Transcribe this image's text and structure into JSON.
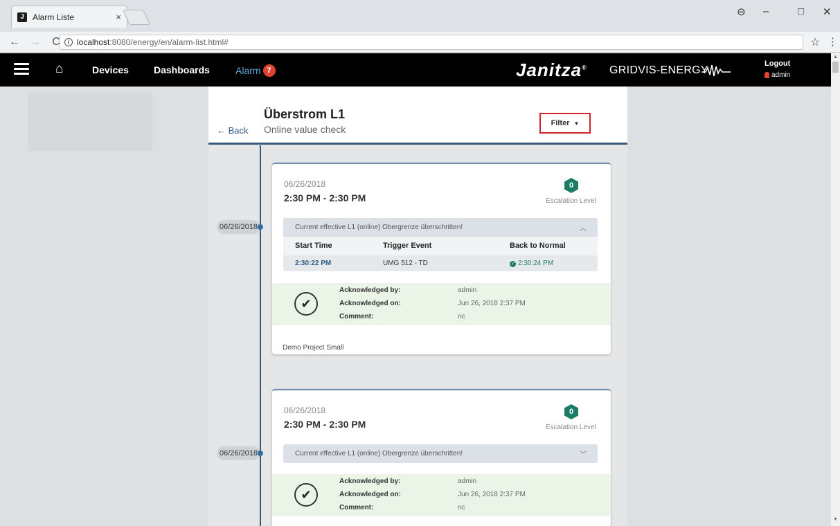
{
  "browser": {
    "tab_title": "Alarm Liste",
    "tab_close": "×",
    "favicon": "J",
    "url_host": "localhost",
    "url_path": ":8080/energy/en/alarm-list.html#",
    "window_controls": [
      "–",
      "□",
      "✕"
    ]
  },
  "header": {
    "nav": {
      "devices": "Devices",
      "dashboards": "Dashboards",
      "alarm": "Alarm",
      "alarm_count": "7"
    },
    "brand": "Janitza",
    "brand_mark": "®",
    "product": "GRIDVIS-ENERGY",
    "logout": "Logout",
    "user": "admin",
    "colors": {
      "accent_alarm": "#5ba7d6",
      "badge": "#e0442f"
    }
  },
  "page": {
    "back": "Back",
    "title": "Überstrom L1",
    "subtitle": "Online value check",
    "filter": "Filter"
  },
  "alarms": [
    {
      "timeline_date": "06/26/2018",
      "date": "06/26/2018",
      "time_range": "2:30 PM - 2:30 PM",
      "escalation_value": "0",
      "escalation_label": "Escalation Level",
      "event_text": "Current effective L1 (online) Obergrenze überschritten!",
      "expanded": true,
      "columns": [
        "Start Time",
        "Trigger Event",
        "Back to Normal"
      ],
      "row": {
        "start": "2:30:22 PM",
        "trigger": "UMG 512 - TD",
        "normal": "2:30:24 PM"
      },
      "ack_labels": [
        "Acknowledged by:",
        "Acknowledged on:",
        "Comment:"
      ],
      "ack_values": [
        "admin",
        "Jun 26, 2018 2:37 PM",
        "nc"
      ],
      "project": "Demo Project Small"
    },
    {
      "timeline_date": "06/26/2018",
      "date": "06/26/2018",
      "time_range": "2:30 PM - 2:30 PM",
      "escalation_value": "0",
      "escalation_label": "Escalation Level",
      "event_text": "Current effective L1 (online) Obergrenze überschritten!",
      "expanded": false,
      "ack_labels": [
        "Acknowledged by:",
        "Acknowledged on:",
        "Comment:"
      ],
      "ack_values": [
        "admin",
        "Jun 26, 2018 2:37 PM",
        "nc"
      ]
    }
  ],
  "colors": {
    "escalation": "#1b7d65",
    "header_underline": "#3a5a78",
    "ack_background": "#eaf5e8",
    "filter_highlight": "#d0202a"
  }
}
